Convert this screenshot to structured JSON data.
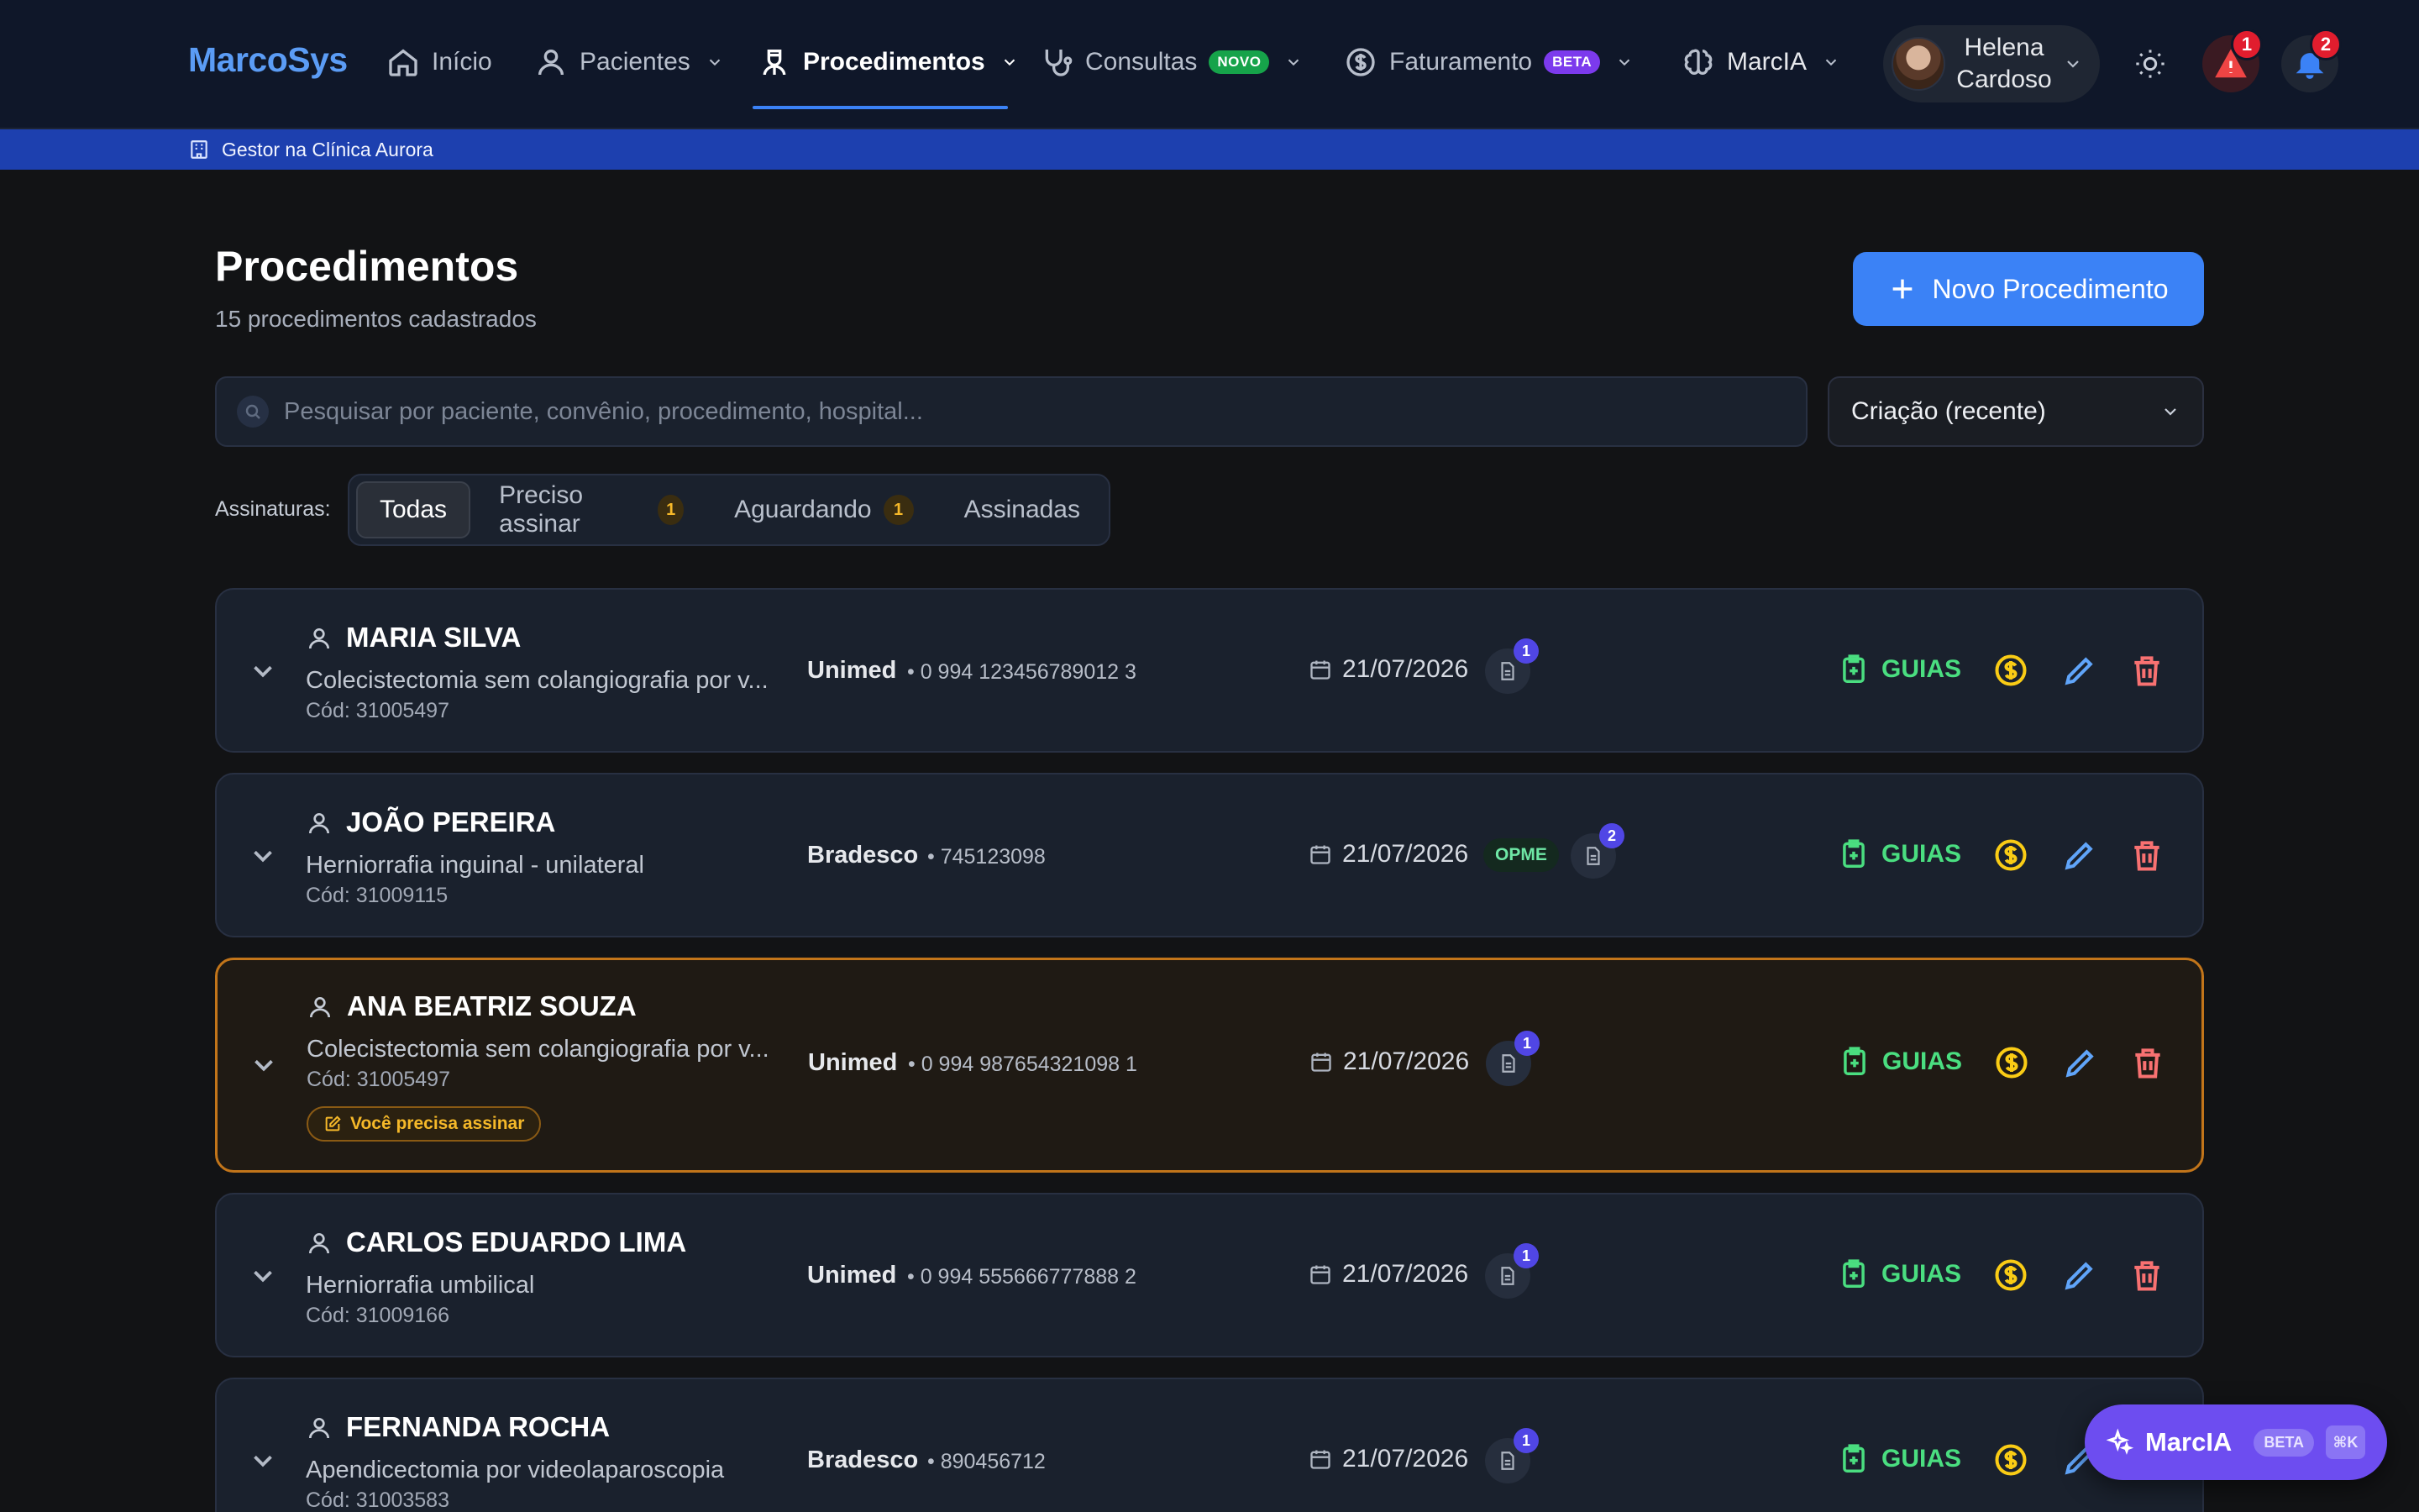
{
  "app": {
    "brand": "MarcoSys"
  },
  "nav": {
    "items": [
      {
        "label": "Início"
      },
      {
        "label": "Pacientes"
      },
      {
        "label": "Procedimentos"
      },
      {
        "label": "Consultas",
        "badge": "NOVO"
      },
      {
        "label": "Faturamento",
        "badge": "BETA"
      },
      {
        "label": "MarcIA"
      }
    ],
    "active": "Procedimentos"
  },
  "user": {
    "name_line1": "Helena",
    "name_line2": "Cardoso"
  },
  "alerts": {
    "warning_count": "1",
    "notification_count": "2"
  },
  "subbar": {
    "text": "Gestor na Clínica Aurora"
  },
  "page": {
    "title": "Procedimentos",
    "subtitle": "15 procedimentos cadastrados",
    "new_button": "Novo Procedimento"
  },
  "search": {
    "placeholder": "Pesquisar por paciente, convênio, procedimento, hospital...",
    "value": ""
  },
  "sort": {
    "selected": "Criação (recente)"
  },
  "filters": {
    "label": "Assinaturas:",
    "tabs": [
      {
        "label": "Todas",
        "active": true
      },
      {
        "label": "Preciso assinar",
        "count": "1"
      },
      {
        "label": "Aguardando",
        "count": "1"
      },
      {
        "label": "Assinadas"
      }
    ]
  },
  "procedures": [
    {
      "patient": "MARIA SILVA",
      "procedure": "Colecistectomia sem colangiografia por v...",
      "code": "Cód: 31005497",
      "insurer": "Unimed",
      "card_number": "• 0 994 123456789012 3",
      "date": "21/07/2026",
      "docs": "1",
      "guias_label": "GUIAS"
    },
    {
      "patient": "JOÃO PEREIRA",
      "procedure": "Herniorrafia inguinal - unilateral",
      "code": "Cód: 31009115",
      "insurer": "Bradesco",
      "card_number": "• 745123098",
      "date": "21/07/2026",
      "opme": "OPME",
      "docs": "2",
      "guias_label": "GUIAS"
    },
    {
      "patient": "ANA BEATRIZ SOUZA",
      "procedure": "Colecistectomia sem colangiografia por v...",
      "code": "Cód: 31005497",
      "insurer": "Unimed",
      "card_number": "• 0 994 987654321098 1",
      "date": "21/07/2026",
      "docs": "1",
      "sign_badge": "Você precisa assinar",
      "guias_label": "GUIAS"
    },
    {
      "patient": "CARLOS EDUARDO LIMA",
      "procedure": "Herniorrafia umbilical",
      "code": "Cód: 31009166",
      "insurer": "Unimed",
      "card_number": "• 0 994 555666777888 2",
      "date": "21/07/2026",
      "docs": "1",
      "guias_label": "GUIAS"
    },
    {
      "patient": "FERNANDA ROCHA",
      "procedure": "Apendicectomia por videolaparoscopia",
      "code": "Cód: 31003583",
      "insurer": "Bradesco",
      "card_number": "• 890456712",
      "date": "21/07/2026",
      "docs": "1",
      "guias_label": "GUIAS"
    }
  ],
  "assistant": {
    "label": "MarcIA",
    "badge": "BETA",
    "shortcut": "⌘K"
  },
  "colors": {
    "accent": "#3b82f6",
    "background": "#121315",
    "nav_bg": "#0f1729",
    "subbar_bg": "#1d40af",
    "guias": "#4ade80",
    "money": "#facc15",
    "edit": "#60a5fa",
    "delete": "#f87171",
    "highlight_border": "#c2751a",
    "assistant": "#6d4df0"
  }
}
